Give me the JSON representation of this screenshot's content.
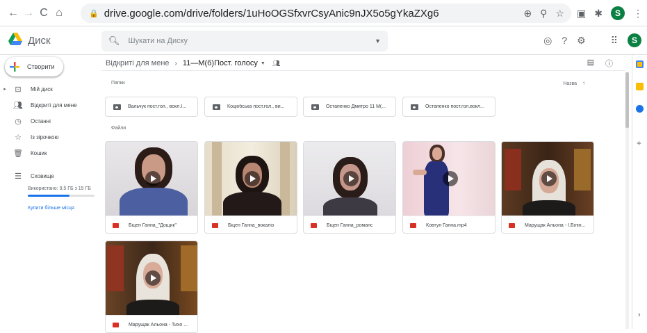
{
  "browser": {
    "url": "drive.google.com/drive/folders/1uHoOGSfxvrCsyAnic9nJX5o5gYkaZXg6",
    "profile_initial": "S"
  },
  "app": {
    "name": "Диск",
    "search_placeholder": "Шукати на Диску",
    "profile_initial": "S"
  },
  "sidebar": {
    "create_label": "Створити",
    "items": [
      {
        "label": "Мій диск",
        "icon": "my-drive-icon"
      },
      {
        "label": "Відкриті для мене",
        "icon": "shared-icon"
      },
      {
        "label": "Останні",
        "icon": "clock-icon"
      },
      {
        "label": "Із зірочкою",
        "icon": "star-icon"
      },
      {
        "label": "Кошик",
        "icon": "trash-icon"
      },
      {
        "label": "Сховище",
        "icon": "storage-icon"
      }
    ],
    "storage_text": "Використано: 9,5 ГБ з 15 ГБ",
    "storage_fraction": 0.63,
    "buy_label": "Купити більше місця"
  },
  "breadcrumb": {
    "root": "Відкриті для мене",
    "current": "11—М(б)Пост. голосу"
  },
  "sections": {
    "folders_label": "Папки",
    "files_label": "Файли",
    "sort_label": "Назва"
  },
  "folders": [
    {
      "name": "Вальчук пост.гол., вокл.І..."
    },
    {
      "name": "Коцюбська пост.гол., ви..."
    },
    {
      "name": "Остапенко Дмитро 11 М(..."
    },
    {
      "name": "Остапенко пост.гол.вокл..."
    }
  ],
  "files": [
    {
      "name": "Біцен Ганна_\"Дощик\""
    },
    {
      "name": "Біцен Ганна_вокаліз"
    },
    {
      "name": "Біцен Ганна_романс"
    },
    {
      "name": "Ковтун Ганна.mp4"
    },
    {
      "name": "Марущак Альона - І.Білін..."
    },
    {
      "name": "Марущак Альона - Тихо ..."
    }
  ]
}
